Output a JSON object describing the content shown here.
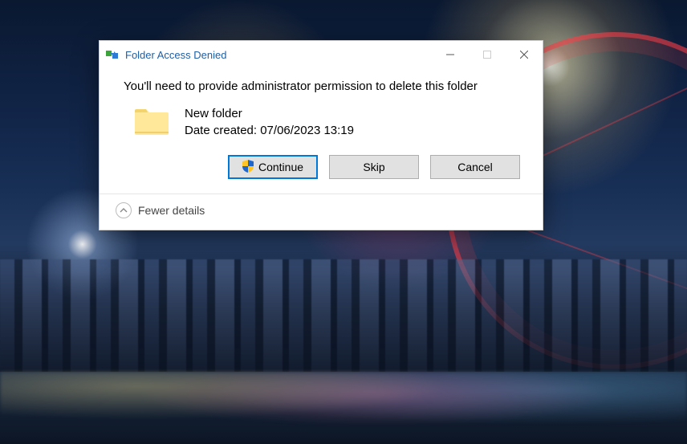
{
  "dialog": {
    "title": "Folder Access Denied",
    "message": "You'll need to provide administrator permission to delete this folder",
    "item": {
      "name": "New folder",
      "date_label": "Date created: 07/06/2023 13:19"
    },
    "buttons": {
      "continue": "Continue",
      "skip": "Skip",
      "cancel": "Cancel"
    },
    "details_toggle": "Fewer details"
  }
}
